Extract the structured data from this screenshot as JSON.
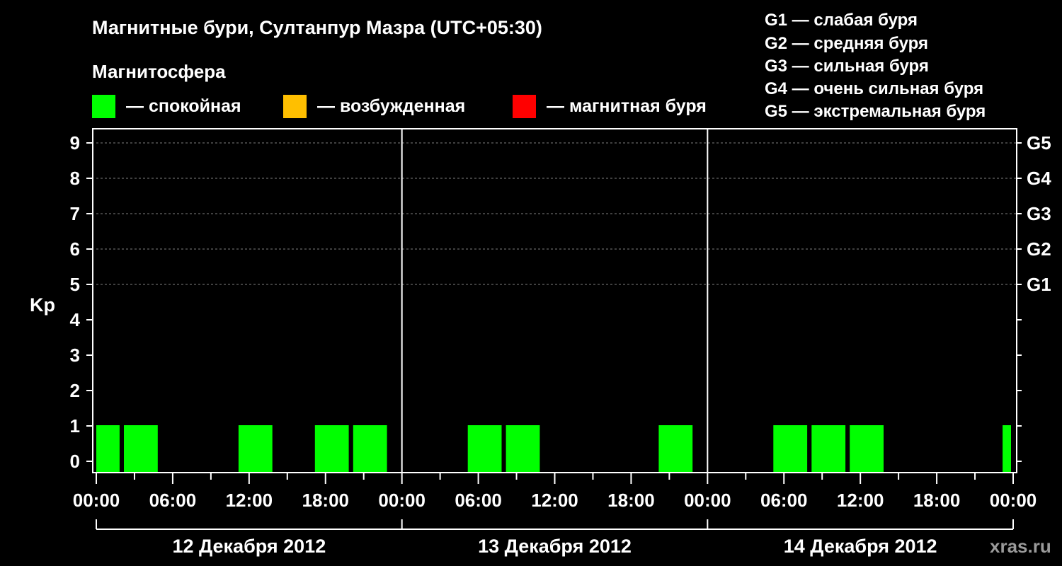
{
  "header": {
    "title": "Магнитные бури, Султанпур Мазра (UTC+05:30)",
    "magnetosphere_label": "Магнитосфера"
  },
  "legend": {
    "states": [
      {
        "label": "— спокойная",
        "color": "#00ff00"
      },
      {
        "label": "— возбужденная",
        "color": "#ffbf00"
      },
      {
        "label": "— магнитная буря",
        "color": "#ff0000"
      }
    ],
    "storm_levels": [
      "G1 — слабая буря",
      "G2 — средняя буря",
      "G3 — сильная буря",
      "G4 — очень сильная буря",
      "G5 — экстремальная буря"
    ]
  },
  "watermark": "xras.ru",
  "chart_data": {
    "type": "bar",
    "ylabel": "Kp",
    "ylim": [
      0,
      9
    ],
    "y_ticks": [
      "0",
      "1",
      "2",
      "3",
      "4",
      "5",
      "6",
      "7",
      "8",
      "9"
    ],
    "g_ticks": [
      {
        "label": "G1",
        "kp": 5
      },
      {
        "label": "G2",
        "kp": 6
      },
      {
        "label": "G3",
        "kp": 7
      },
      {
        "label": "G4",
        "kp": 8
      },
      {
        "label": "G5",
        "kp": 9
      }
    ],
    "x_range_hours": [
      0,
      72
    ],
    "x_ticks": [
      "00:00",
      "06:00",
      "12:00",
      "18:00",
      "00:00",
      "06:00",
      "12:00",
      "18:00",
      "00:00",
      "06:00",
      "12:00",
      "18:00",
      "00:00"
    ],
    "days": [
      "12 Декабря 2012",
      "13 Декабря 2012",
      "14 Декабря 2012"
    ],
    "bars": [
      {
        "start": 0.0,
        "end": 1.83,
        "kp": 1,
        "state": "calm"
      },
      {
        "start": 2.17,
        "end": 4.83,
        "kp": 1,
        "state": "calm"
      },
      {
        "start": 11.17,
        "end": 13.83,
        "kp": 1,
        "state": "calm"
      },
      {
        "start": 17.17,
        "end": 19.83,
        "kp": 1,
        "state": "calm"
      },
      {
        "start": 20.17,
        "end": 22.83,
        "kp": 1,
        "state": "calm"
      },
      {
        "start": 29.17,
        "end": 31.83,
        "kp": 1,
        "state": "calm"
      },
      {
        "start": 32.17,
        "end": 34.83,
        "kp": 1,
        "state": "calm"
      },
      {
        "start": 44.17,
        "end": 46.83,
        "kp": 1,
        "state": "calm"
      },
      {
        "start": 53.17,
        "end": 55.83,
        "kp": 1,
        "state": "calm"
      },
      {
        "start": 56.17,
        "end": 58.83,
        "kp": 1,
        "state": "calm"
      },
      {
        "start": 59.17,
        "end": 61.83,
        "kp": 1,
        "state": "calm"
      },
      {
        "start": 71.17,
        "end": 71.83,
        "kp": 1,
        "state": "calm"
      }
    ],
    "colors": {
      "calm": "#00ff00",
      "background": "#000000",
      "axis": "#ffffff",
      "grid": "#808080"
    },
    "grid": "dashed horizontal at G levels",
    "legend_placement": "top"
  }
}
